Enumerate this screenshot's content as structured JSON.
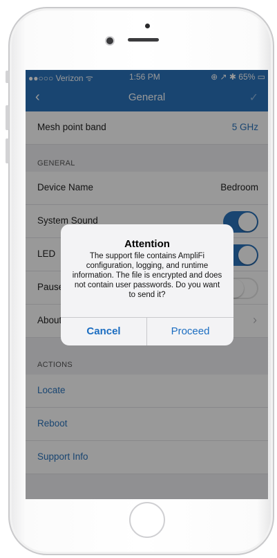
{
  "status_bar": {
    "carrier": "●●○○○ Verizon ᯤ",
    "time": "1:56 PM",
    "battery": "⊕ ↗ ✱ 65% ▭"
  },
  "nav": {
    "title": "General",
    "back_icon": "chevron-left-icon",
    "done_icon": "checkmark-icon"
  },
  "rows": {
    "mesh_band": {
      "label": "Mesh point band",
      "value": "5 GHz"
    },
    "section_general": "GENERAL",
    "device_name": {
      "label": "Device Name",
      "value": "Bedroom"
    },
    "system_sound": {
      "label": "System Sound",
      "on": true
    },
    "led": {
      "label": "LED",
      "on": true
    },
    "pause": {
      "label": "Pause",
      "on": false
    },
    "about": {
      "label": "About"
    },
    "section_actions": "ACTIONS",
    "locate": "Locate",
    "reboot": "Reboot",
    "support_info": "Support Info"
  },
  "alert": {
    "title": "Attention",
    "message": "The support file contains AmpliFi configuration, logging, and runtime information. The file is encrypted and does not contain user passwords. Do you want to send it?",
    "cancel": "Cancel",
    "proceed": "Proceed"
  },
  "colors": {
    "accent": "#2b74bd",
    "alert_button": "#1b6dc1"
  }
}
